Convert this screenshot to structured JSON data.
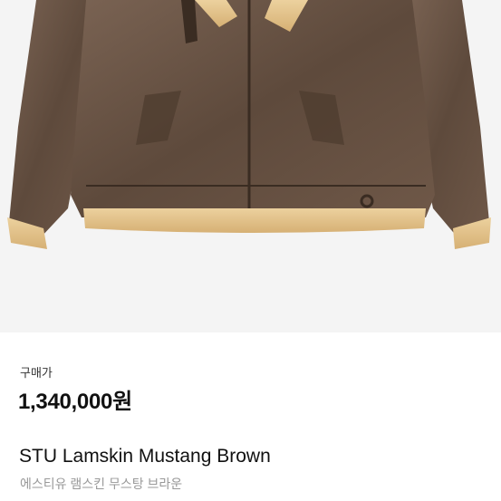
{
  "product": {
    "image_icon": "leather-shearling-jacket-icon",
    "price_label": "구매가",
    "price": "1,340,000원",
    "name_en": "STU Lamskin Mustang Brown",
    "name_ko": "에스티유 램스킨 무스탕 브라운"
  },
  "colors": {
    "leather": "#6b5647",
    "shearling": "#e3c28b",
    "background": "#f4f4f4",
    "price_text": "#111111",
    "subtitle_text": "#999999"
  }
}
